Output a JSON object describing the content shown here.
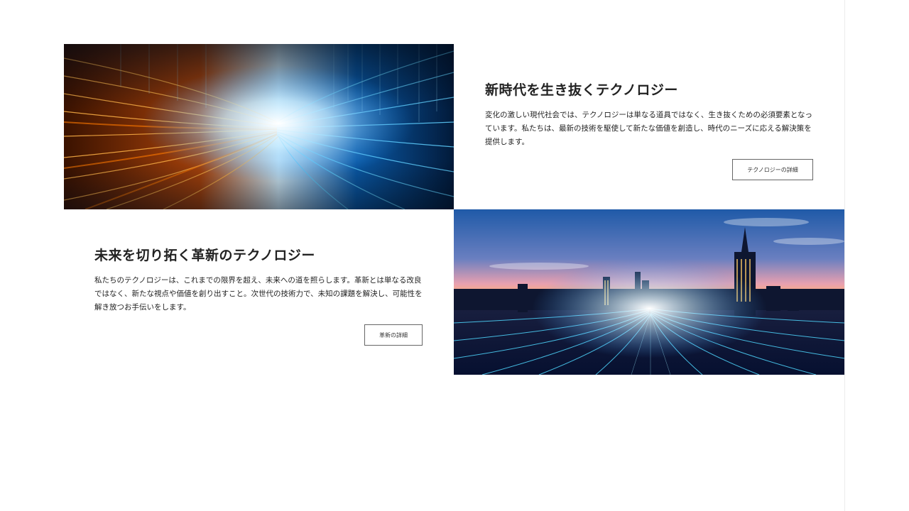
{
  "section_tech": {
    "heading": "新時代を生き抜くテクノロジー",
    "body": "変化の激しい現代社会では、テクノロジーは単なる道具ではなく、生き抜くための必須要素となっています。私たちは、最新の技術を駆使して新たな価値を創造し、時代のニーズに応える解決策を提供します。",
    "button_label": "テクノロジーの詳細"
  },
  "section_innovation": {
    "heading": "未来を切り拓く革新のテクノロジー",
    "body": "私たちのテクノロジーは、これまでの限界を超え、未来への道を照らします。革新とは単なる改良ではなく、新たな視点や価値を創り出すこと。次世代の技術力で、未知の課題を解決し、可能性を解き放つお手伝いをします。",
    "button_label": "革新の詳細"
  },
  "colors": {
    "orange_light": "#ff8a1c",
    "blue_light": "#1ea8ff",
    "text": "#222222",
    "button_border": "#666666"
  }
}
